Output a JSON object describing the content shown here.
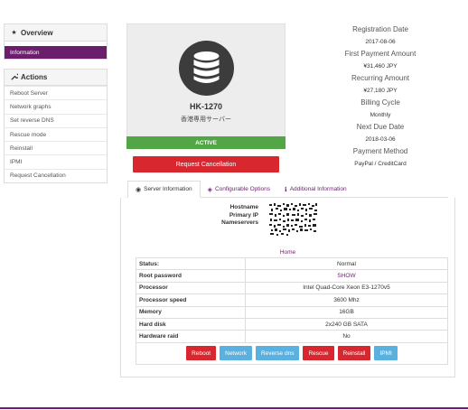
{
  "sidebar": {
    "overview_title": "Overview",
    "overview_items": [
      "Information"
    ],
    "actions_title": "Actions",
    "actions": [
      "Reboot Server",
      "Network graphs",
      "Set reverse DNS",
      "Rescue mode",
      "Reinstall",
      "IPMI",
      "Request Cancellation"
    ]
  },
  "product": {
    "name": "HK-1270",
    "subtitle": "香港専用サーバー",
    "status": "ACTIVE",
    "cancel_label": "Request Cancellation",
    "icon": "database-icon"
  },
  "info": {
    "registration_label": "Registration Date",
    "registration_value": "2017-08-06",
    "first_payment_label": "First Payment Amount",
    "first_payment_value": "¥31,460 JPY",
    "recurring_label": "Recurring Amount",
    "recurring_value": "¥27,180 JPY",
    "billing_label": "Billing Cycle",
    "billing_value": "Monthly",
    "due_label": "Next Due Date",
    "due_value": "2018-03-06",
    "payment_label": "Payment Method",
    "payment_value": "PayPal / CreditCard"
  },
  "tabs": [
    {
      "label": "Server Information",
      "icon": "globe-icon"
    },
    {
      "label": "Configurable Options",
      "icon": "cubes-icon"
    },
    {
      "label": "Additional Information",
      "icon": "info-icon"
    }
  ],
  "server": {
    "hostname_label": "Hostname",
    "primary_ip_label": "Primary IP",
    "nameservers_label": "Nameservers",
    "home_link": "Home"
  },
  "details": [
    {
      "label": "Status:",
      "value": "Normal",
      "link": false
    },
    {
      "label": "Root password",
      "value": "SHOW",
      "link": true
    },
    {
      "label": "Processor",
      "value": "Intel Quad-Core Xeon E3-1270v5",
      "link": false
    },
    {
      "label": "Processor speed",
      "value": "3600 Mhz",
      "link": false
    },
    {
      "label": "Memory",
      "value": "16GB",
      "link": false
    },
    {
      "label": "Hard disk",
      "value": "2x240 GB SATA",
      "link": false
    },
    {
      "label": "Hardware raid",
      "value": "No",
      "link": false
    }
  ],
  "buttons": [
    {
      "label": "Reboot",
      "color": "#d9272f"
    },
    {
      "label": "Network",
      "color": "#5ab1e0"
    },
    {
      "label": "Reverse dns",
      "color": "#5ab1e0"
    },
    {
      "label": "Rescue",
      "color": "#d9272f"
    },
    {
      "label": "Reinstall",
      "color": "#d9272f"
    },
    {
      "label": "IPMI",
      "color": "#5ab1e0"
    }
  ],
  "colors": {
    "brand": "#6b1e6b",
    "active": "#52a645",
    "danger": "#d9272f",
    "info": "#5ab1e0"
  }
}
